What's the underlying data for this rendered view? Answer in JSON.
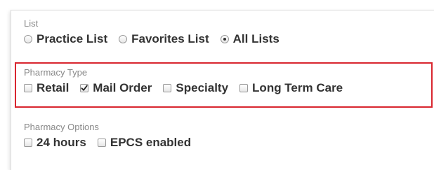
{
  "list_section": {
    "label": "List",
    "options": [
      {
        "label": "Practice List",
        "selected": false
      },
      {
        "label": "Favorites List",
        "selected": false
      },
      {
        "label": "All Lists",
        "selected": true
      }
    ]
  },
  "pharmacy_type_section": {
    "label": "Pharmacy Type",
    "options": [
      {
        "label": "Retail",
        "checked": false
      },
      {
        "label": "Mail Order",
        "checked": true
      },
      {
        "label": "Specialty",
        "checked": false
      },
      {
        "label": "Long Term Care",
        "checked": false
      }
    ],
    "highlight_color": "#d9262f"
  },
  "pharmacy_options_section": {
    "label": "Pharmacy Options",
    "options": [
      {
        "label": "24 hours",
        "checked": false
      },
      {
        "label": "EPCS enabled",
        "checked": false
      }
    ]
  }
}
